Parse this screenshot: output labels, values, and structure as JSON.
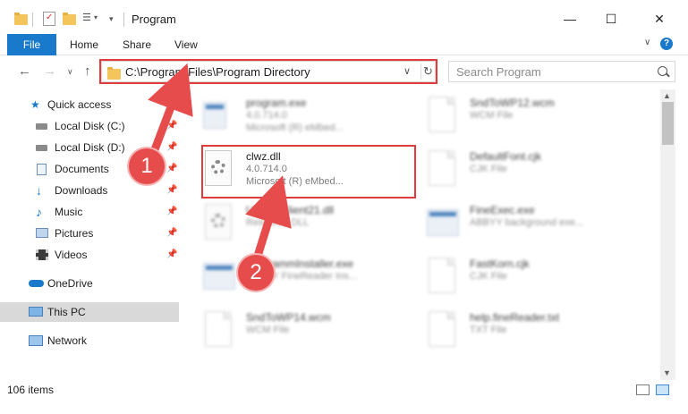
{
  "window": {
    "title": "Program",
    "minimize": "—",
    "maximize": "☐",
    "close": "✕"
  },
  "ribbon": {
    "tabs": [
      "File",
      "Home",
      "Share",
      "View"
    ],
    "expand": "∨",
    "help": "?"
  },
  "address_bar": {
    "path": "C:\\Program Files\\Program Directory",
    "dropdown": "∨",
    "refresh": "↻"
  },
  "search": {
    "placeholder": "Search Program"
  },
  "sidebar": {
    "items": [
      {
        "label": "Quick access",
        "icon": "star-icon"
      },
      {
        "label": "Local Disk (C:)",
        "icon": "drive-icon",
        "pinned": true
      },
      {
        "label": "Local Disk (D:)",
        "icon": "drive-icon",
        "pinned": true
      },
      {
        "label": "Documents",
        "icon": "documents-icon",
        "pinned": true
      },
      {
        "label": "Downloads",
        "icon": "download-icon",
        "pinned": true
      },
      {
        "label": "Music",
        "icon": "music-icon",
        "pinned": true
      },
      {
        "label": "Pictures",
        "icon": "pictures-icon",
        "pinned": true
      },
      {
        "label": "Videos",
        "icon": "videos-icon",
        "pinned": true
      },
      {
        "label": "OneDrive",
        "icon": "cloud-icon"
      },
      {
        "label": "This PC",
        "icon": "computer-icon",
        "selected": true
      },
      {
        "label": "Network",
        "icon": "network-icon"
      }
    ],
    "pin_glyph": "📌"
  },
  "files": {
    "left": [
      {
        "name": "program.exe",
        "line1": "4.0.714.0",
        "line2": "Microsoft (R) eMbed...",
        "icon": "app-icon",
        "blurred": true
      },
      {
        "name": "clwz.dll",
        "line1": "4.0.714.0",
        "line2": "Microsoft (R) eMbed...",
        "icon": "dll-gear-icon",
        "blurred": false
      },
      {
        "name": "UpdateClient21.dll",
        "line1": "Resource DLL",
        "line2": "",
        "icon": "dll-gear-icon",
        "blurred": true
      },
      {
        "name": "ProgrammInstaller.exe",
        "line1": "ABBYY FineReader Ins...",
        "line2": "",
        "icon": "app-icon",
        "blurred": true
      },
      {
        "name": "SndToWP14.wcm",
        "line1": "WCM File",
        "line2": "",
        "icon": "document-icon",
        "blurred": true
      }
    ],
    "right": [
      {
        "name": "SndToWP12.wcm",
        "line1": "WCM File",
        "line2": "",
        "icon": "document-icon"
      },
      {
        "name": "DefaultFont.cjk",
        "line1": "CJK File",
        "line2": "",
        "icon": "document-icon"
      },
      {
        "name": "FineExec.exe",
        "line1": "ABBYY background exe...",
        "line2": "",
        "icon": "app-icon"
      },
      {
        "name": "FastKorn.cjk",
        "line1": "CJK File",
        "line2": "",
        "icon": "document-icon"
      },
      {
        "name": "help.fineReader.txt",
        "line1": "TXT File",
        "line2": "",
        "icon": "document-icon"
      }
    ]
  },
  "status": {
    "item_count": "106 items"
  },
  "annotations": {
    "step1": "1",
    "step2": "2",
    "color": "#e74c4c"
  },
  "colors": {
    "accent": "#1979ca",
    "highlight": "#e03c3c"
  }
}
